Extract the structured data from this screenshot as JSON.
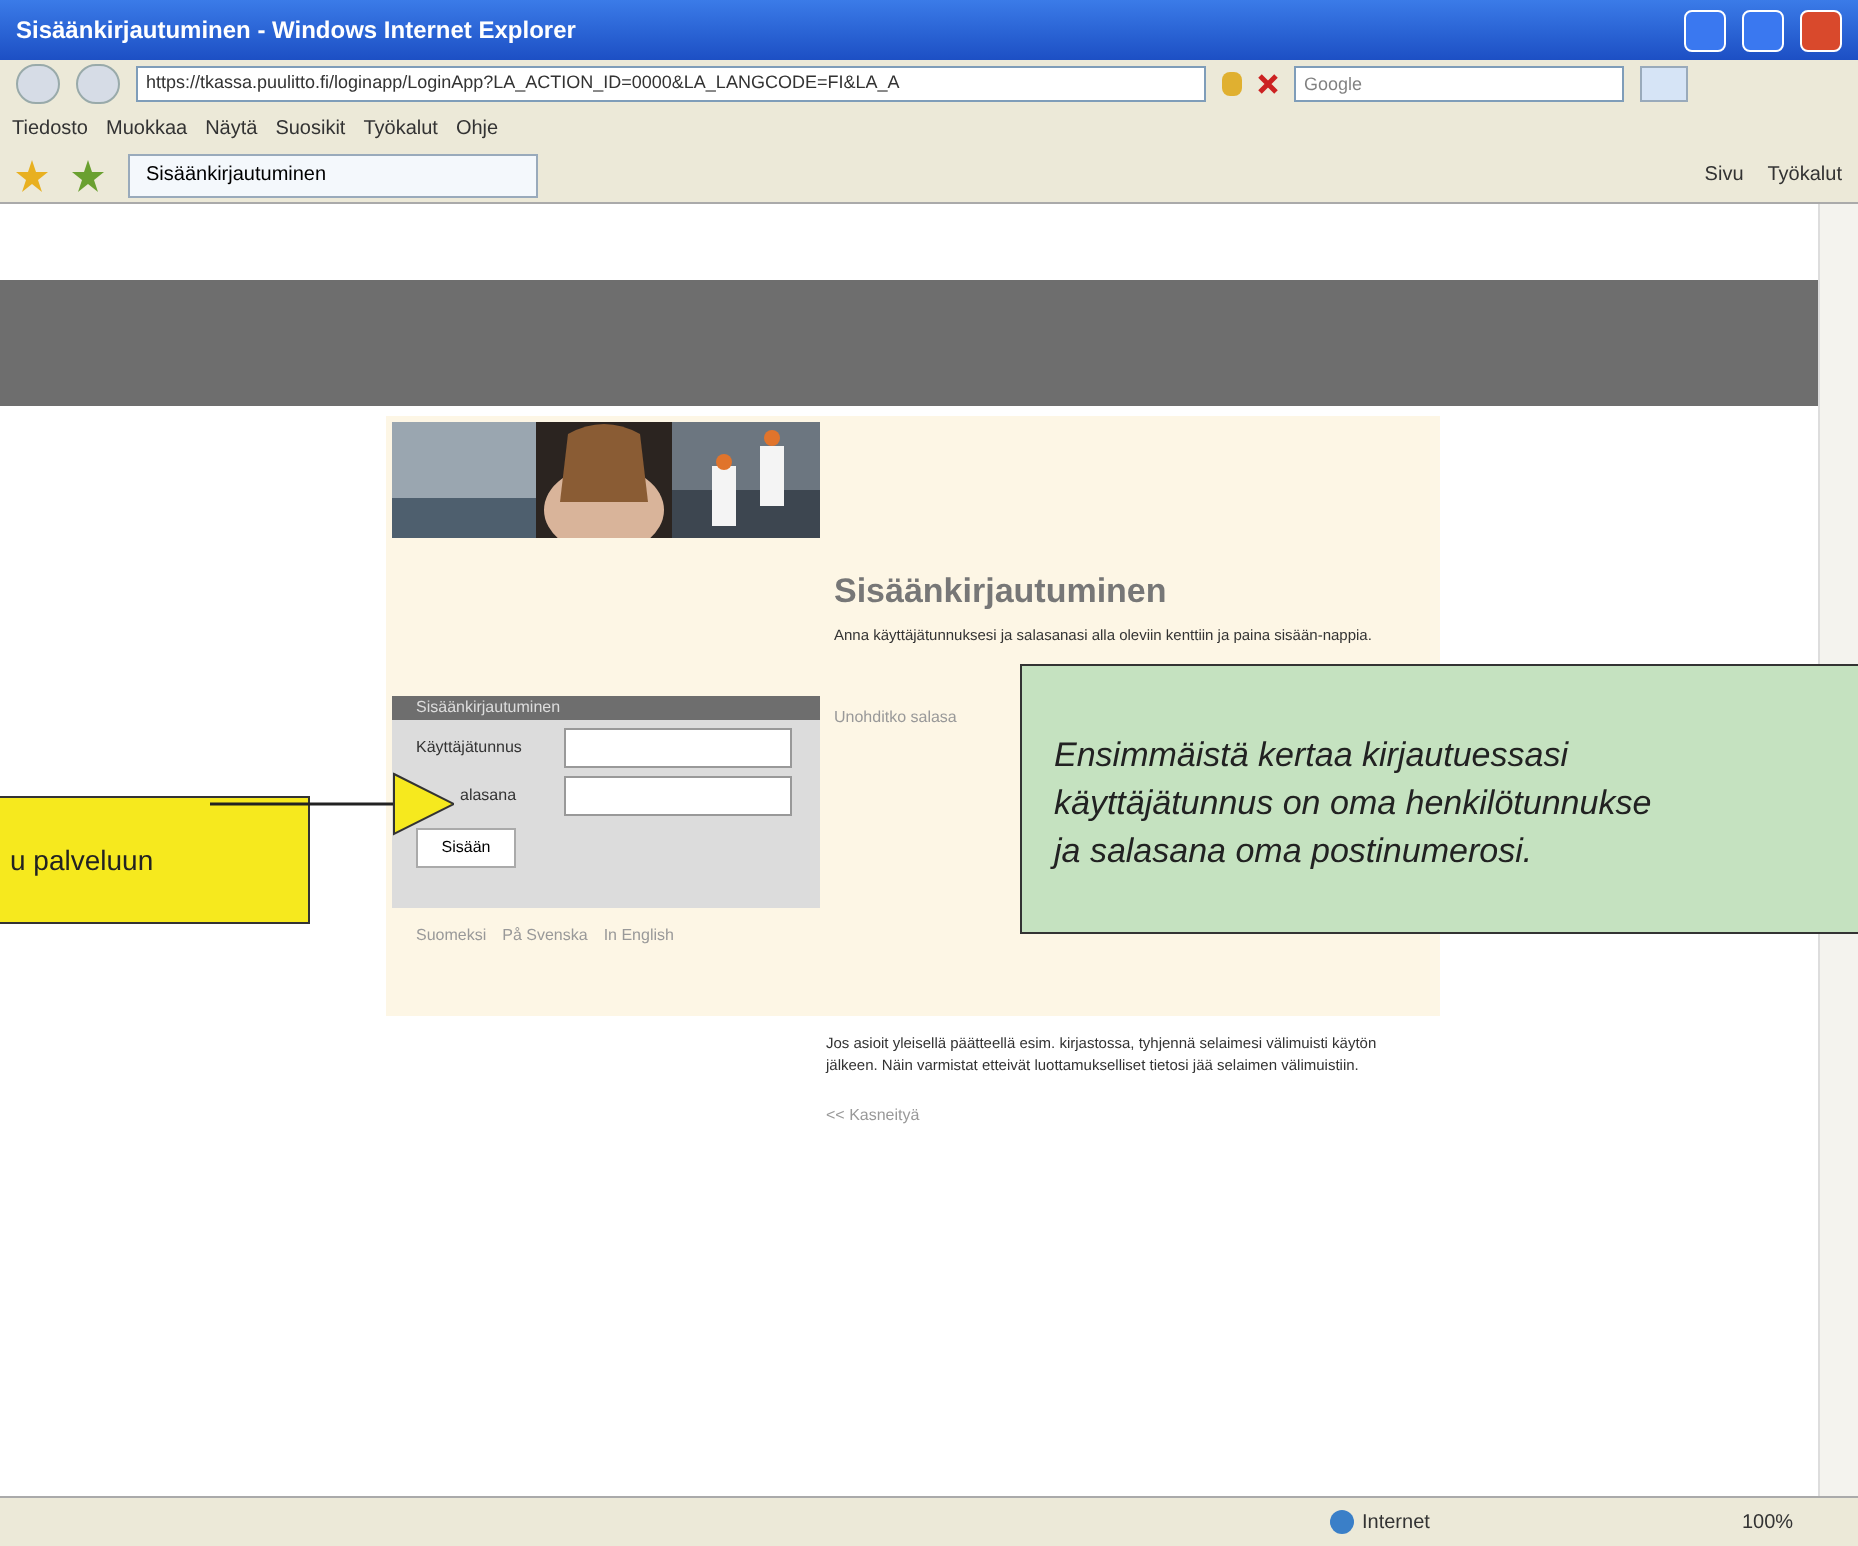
{
  "window": {
    "title": "Sisäänkirjautuminen - Windows Internet Explorer"
  },
  "address_bar": {
    "url": "https://tkassa.puulitto.fi/loginapp/LoginApp?LA_ACTION_ID=0000&LA_LANGCODE=FI&LA_A",
    "search_placeholder": "Google"
  },
  "menu": [
    "Tiedosto",
    "Muokkaa",
    "Näytä",
    "Suosikit",
    "Työkalut",
    "Ohje"
  ],
  "tab": {
    "label": "Sisäänkirjautuminen"
  },
  "toolbar": [
    "Sivu",
    "Työkalut"
  ],
  "page": {
    "heading": "Sisäänkirjautuminen",
    "intro": "Anna käyttäjätunnuksesi ja salasanasi alla oleviin kenttiin ja paina sisään-nappia.",
    "login_box": {
      "title": "Sisäänkirjautuminen",
      "fields": [
        {
          "label": "Käyttäjätunnus"
        },
        {
          "label": "alasana"
        }
      ],
      "button": "Sisään"
    },
    "forgot_link": "Unohditko salasa",
    "languages": [
      "Suomeksi",
      "På Svenska",
      "In English"
    ],
    "notice": "Jos asioit yleisellä päätteellä esim. kirjastossa, tyhjennä selaimesi välimuisti käytön jälkeen. Näin varmistat etteivät luottamukselliset tietosi jää selaimen välimuistiin.",
    "back_link": "<< Kasneityä"
  },
  "callouts": [
    {
      "kind": "yellow",
      "lines": [
        "u palveluun"
      ]
    },
    {
      "kind": "green",
      "lines": [
        "Ensimmäistä kertaa kirjautuessasi",
        "käyttäjätunnus on oma henkilötunnukse",
        "ja salasana oma postinumerosi."
      ]
    }
  ],
  "status_bar": {
    "zone": "Internet",
    "zoom": "100%"
  }
}
